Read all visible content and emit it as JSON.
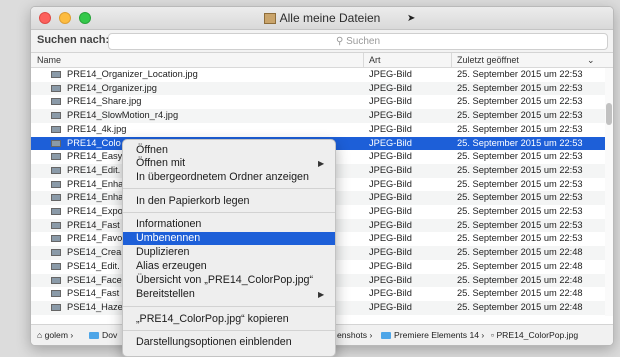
{
  "window": {
    "title": "Alle meine Dateien"
  },
  "search": {
    "label": "Suchen nach:",
    "placeholder": "Suchen"
  },
  "columns": {
    "name": "Name",
    "kind": "Art",
    "last_opened": "Zuletzt geöffnet"
  },
  "rows": [
    {
      "name": "PRE14_Organizer_Location.jpg",
      "kind": "JPEG-Bild",
      "date": "25. September 2015 um 22:53"
    },
    {
      "name": "PRE14_Organizer.jpg",
      "kind": "JPEG-Bild",
      "date": "25. September 2015 um 22:53"
    },
    {
      "name": "PRE14_Share.jpg",
      "kind": "JPEG-Bild",
      "date": "25. September 2015 um 22:53"
    },
    {
      "name": "PRE14_SlowMotion_r4.jpg",
      "kind": "JPEG-Bild",
      "date": "25. September 2015 um 22:53"
    },
    {
      "name": "PRE14_4k.jpg",
      "kind": "JPEG-Bild",
      "date": "25. September 2015 um 22:53"
    },
    {
      "name": "PRE14_Colo",
      "kind": "JPEG-Bild",
      "date": "25. September 2015 um 22:53"
    },
    {
      "name": "PRE14_Easy",
      "kind": "JPEG-Bild",
      "date": "25. September 2015 um 22:53"
    },
    {
      "name": "PRE14_Edit.",
      "kind": "JPEG-Bild",
      "date": "25. September 2015 um 22:53"
    },
    {
      "name": "PRE14_Enha",
      "kind": "JPEG-Bild",
      "date": "25. September 2015 um 22:53"
    },
    {
      "name": "PRE14_Enha",
      "kind": "JPEG-Bild",
      "date": "25. September 2015 um 22:53"
    },
    {
      "name": "PRE14_Expo",
      "kind": "JPEG-Bild",
      "date": "25. September 2015 um 22:53"
    },
    {
      "name": "PRE14_Fast",
      "kind": "JPEG-Bild",
      "date": "25. September 2015 um 22:53"
    },
    {
      "name": "PRE14_Favo",
      "kind": "JPEG-Bild",
      "date": "25. September 2015 um 22:53"
    },
    {
      "name": "PSE14_Crea",
      "kind": "JPEG-Bild",
      "date": "25. September 2015 um 22:48"
    },
    {
      "name": "PSE14_Edit.",
      "kind": "JPEG-Bild",
      "date": "25. September 2015 um 22:48"
    },
    {
      "name": "PSE14_Face",
      "kind": "JPEG-Bild",
      "date": "25. September 2015 um 22:48"
    },
    {
      "name": "PSE14_Fast",
      "kind": "JPEG-Bild",
      "date": "25. September 2015 um 22:48"
    },
    {
      "name": "PSE14_Haze",
      "kind": "JPEG-Bild",
      "date": "25. September 2015 um 22:48"
    }
  ],
  "pathbar": {
    "home": "golem",
    "seg2": "Dov",
    "seg3": "enshots",
    "seg4": "Premiere Elements 14",
    "file": "PRE14_ColorPop.jpg"
  },
  "context_menu": {
    "open": "Öffnen",
    "open_with": "Öffnen mit",
    "show_in_folder": "In übergeordnetem Ordner anzeigen",
    "trash": "In den Papierkorb legen",
    "info": "Informationen",
    "rename": "Umbenennen",
    "duplicate": "Duplizieren",
    "alias": "Alias erzeugen",
    "quicklook": "Übersicht von „PRE14_ColorPop.jpg“",
    "share": "Bereitstellen",
    "copy": "„PRE14_ColorPop.jpg“ kopieren",
    "view_options": "Darstellungsoptionen einblenden"
  }
}
